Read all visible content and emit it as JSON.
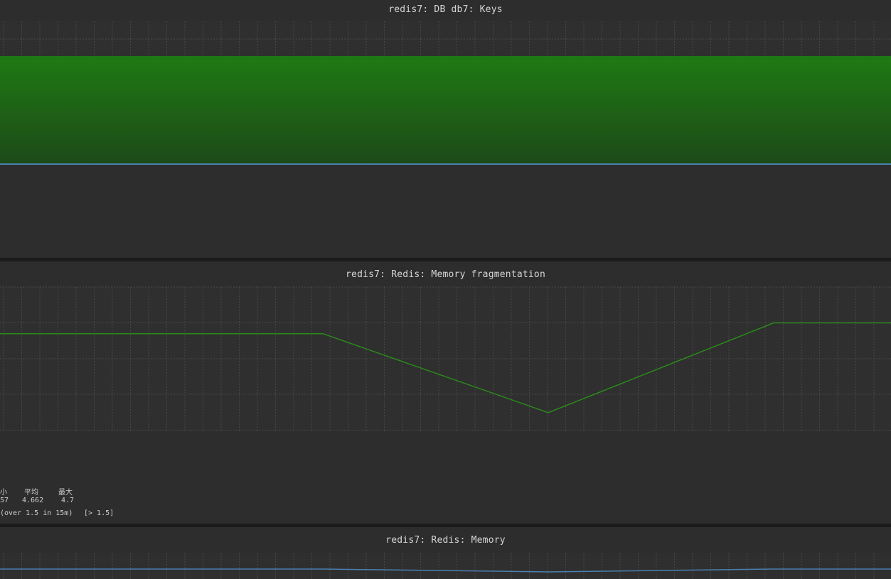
{
  "panels": {
    "keys": {
      "title": "redis7: DB db7: Keys",
      "colors": {
        "area_top": "#1f7a13",
        "area_bottom": "#1d4a18",
        "line": "#4a7fae"
      }
    },
    "fragmentation": {
      "title": "redis7: Redis: Memory fragmentation",
      "legend": {
        "headers": [
          "小",
          "平均",
          "最大"
        ],
        "values": [
          "57",
          "4.662",
          "4.7"
        ],
        "trigger_text": "(over 1.5 in 15m)",
        "trigger_threshold": "[> 1.5]"
      },
      "colors": {
        "line": "#2a8a1a"
      }
    },
    "memory": {
      "title": "redis7: Redis: Memory",
      "colors": {
        "line": "#4a7fae"
      }
    }
  },
  "chart_data": [
    {
      "type": "area",
      "title": "redis7: DB db7: Keys",
      "x": [
        0,
        1,
        2,
        3,
        4,
        5
      ],
      "series": [
        {
          "values": [
            1,
            1,
            1,
            1,
            1,
            1
          ]
        },
        {
          "values": [
            0,
            0,
            0,
            0,
            0,
            0
          ]
        }
      ],
      "grid": true
    },
    {
      "type": "line",
      "title": "redis7: Redis: Memory fragmentation",
      "x": [
        0,
        454,
        771,
        1088,
        1253
      ],
      "series": [
        {
          "values": [
            4.67,
            4.67,
            4.45,
            4.7,
            4.7
          ]
        }
      ],
      "ylim": [
        4.4,
        4.8
      ],
      "grid": true
    },
    {
      "type": "line",
      "title": "redis7: Redis: Memory",
      "x": [
        0,
        454,
        771,
        1088,
        1253
      ],
      "series": [
        {
          "values": [
            1.0,
            1.0,
            0.98,
            1.0,
            1.0
          ]
        }
      ],
      "grid": true
    }
  ]
}
